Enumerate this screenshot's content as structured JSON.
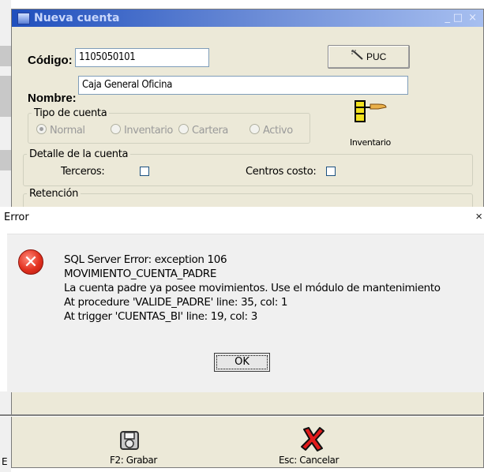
{
  "window": {
    "title": "Nueva cuenta",
    "min_glyph": "_",
    "max_glyph": "□",
    "close_glyph": "×"
  },
  "form": {
    "codigo_label": "Código:",
    "codigo_value": "1105050101",
    "puc_button": "PUC",
    "nombre_label": "Nombre:",
    "nombre_value": "Caja General Oficina",
    "tipo_legend": "Tipo de cuenta",
    "tipo_options": [
      "Normal",
      "Inventario",
      "Cartera",
      "Activo"
    ],
    "tipo_selected": "Normal",
    "inventario_label": "Inventario",
    "detalle_legend": "Detalle de la cuenta",
    "terceros_label": "Terceros:",
    "centros_label": "Centros costo:",
    "retencion_legend": "Retención"
  },
  "error_dialog": {
    "title": "Error",
    "close_glyph": "×",
    "lines": [
      "SQL Server Error: exception 106",
      "MOVIMIENTO_CUENTA_PADRE",
      "La cuenta padre ya posee movimientos. Use el módulo de mantenimiento",
      "At procedure 'VALIDE_PADRE' line: 35, col: 1",
      "At trigger 'CUENTAS_BI' line: 19, col: 3"
    ],
    "ok_button": "OK"
  },
  "footer": {
    "save_label": "F2: Grabar",
    "cancel_label": "Esc: Cancelar"
  },
  "colors": {
    "titlebar": "#1f4fbd",
    "error_icon": "#e2311f",
    "dialog_bg": "#ece9d8"
  }
}
